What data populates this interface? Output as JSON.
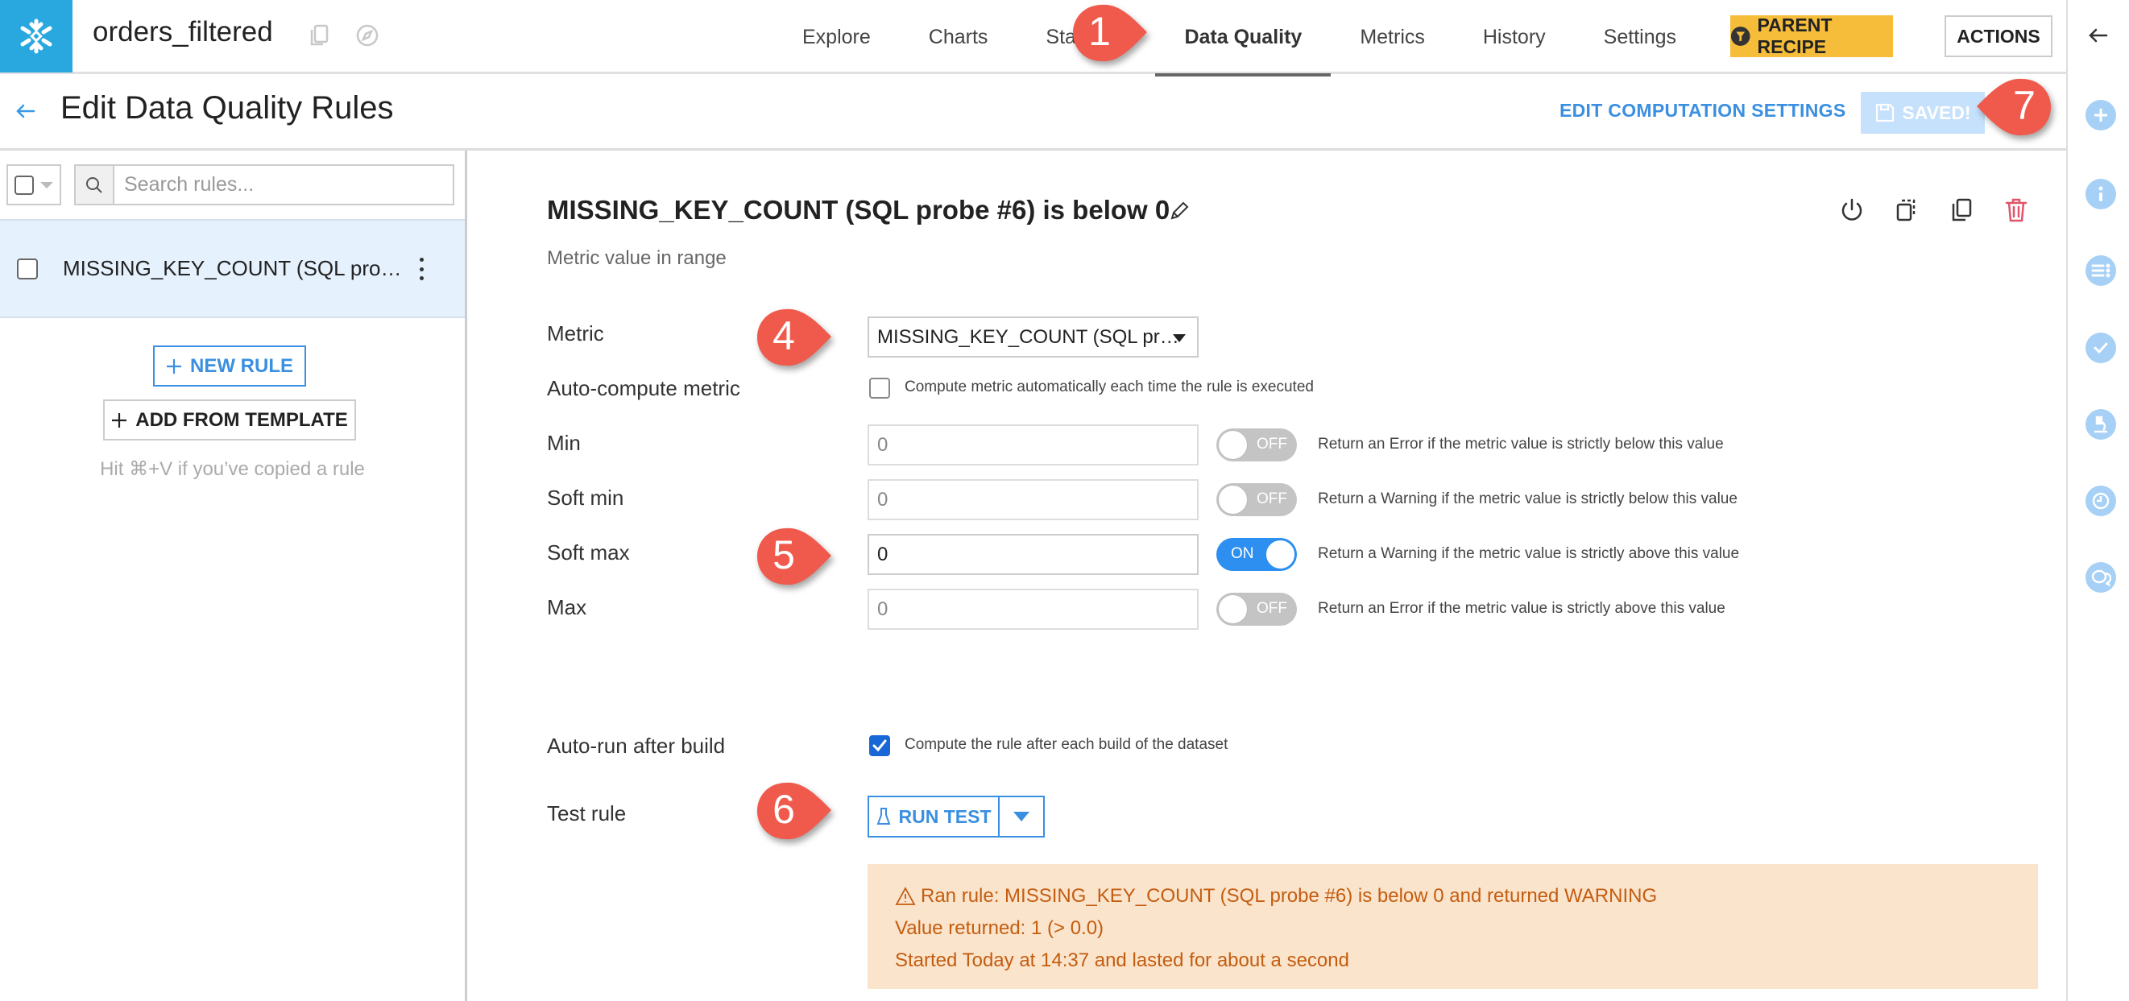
{
  "header": {
    "dataset_name": "orders_filtered",
    "tabs": [
      {
        "label": "Explore",
        "active": false
      },
      {
        "label": "Charts",
        "active": false
      },
      {
        "label": "Statistics",
        "active": false
      },
      {
        "label": "Data Quality",
        "active": true
      },
      {
        "label": "Metrics",
        "active": false
      },
      {
        "label": "History",
        "active": false
      },
      {
        "label": "Settings",
        "active": false
      }
    ],
    "parent_recipe_label": "PARENT RECIPE",
    "actions_label": "ACTIONS",
    "brand_color": "#29a8e0",
    "parent_recipe_color": "#f6bd3a"
  },
  "subheader": {
    "title": "Edit Data Quality Rules",
    "edit_computation_label": "EDIT COMPUTATION SETTINGS",
    "saved_label": "SAVED!"
  },
  "sidebar": {
    "search_placeholder": "Search rules...",
    "rules": [
      {
        "label": "MISSING_KEY_COUNT (SQL pro…",
        "selected": true
      }
    ],
    "new_rule_label": "NEW RULE",
    "add_template_label": "ADD FROM TEMPLATE",
    "hint": "Hit ⌘+V if you’ve copied a rule"
  },
  "rule": {
    "title": "MISSING_KEY_COUNT (SQL probe #6) is below 0",
    "subtitle": "Metric value in range",
    "metric_label": "Metric",
    "metric_value": "MISSING_KEY_COUNT (SQL pr…",
    "auto_compute_label": "Auto-compute metric",
    "auto_compute_checked": false,
    "auto_compute_text": "Compute metric automatically each time the rule is executed",
    "thresholds": [
      {
        "label": "Min",
        "value": "0",
        "enabled": false,
        "toggle_label": "OFF",
        "help": "Return an Error if the metric value is strictly below this value"
      },
      {
        "label": "Soft min",
        "value": "0",
        "enabled": false,
        "toggle_label": "OFF",
        "help": "Return a Warning if the metric value is strictly below this value"
      },
      {
        "label": "Soft max",
        "value": "0",
        "enabled": true,
        "toggle_label": "ON",
        "help": "Return a Warning if the metric value is strictly above this value"
      },
      {
        "label": "Max",
        "value": "0",
        "enabled": false,
        "toggle_label": "OFF",
        "help": "Return an Error if the metric value is strictly above this value"
      }
    ],
    "auto_run_label": "Auto-run after build",
    "auto_run_checked": true,
    "auto_run_text": "Compute the rule after each build of the dataset",
    "test_rule_label": "Test rule",
    "run_test_label": "RUN TEST"
  },
  "result": {
    "line1": "Ran rule: MISSING_KEY_COUNT (SQL probe #6) is below 0 and returned WARNING",
    "line2": "Value returned: 1 (> 0.0)",
    "line3": "Started Today at 14:37 and lasted for about a second",
    "status": "WARNING",
    "background_color": "#fbe4cc",
    "text_color": "#c35d10"
  },
  "callouts": {
    "c1": "1",
    "c4": "4",
    "c5": "5",
    "c6": "6",
    "c7": "7",
    "color": "#f05a4c"
  }
}
